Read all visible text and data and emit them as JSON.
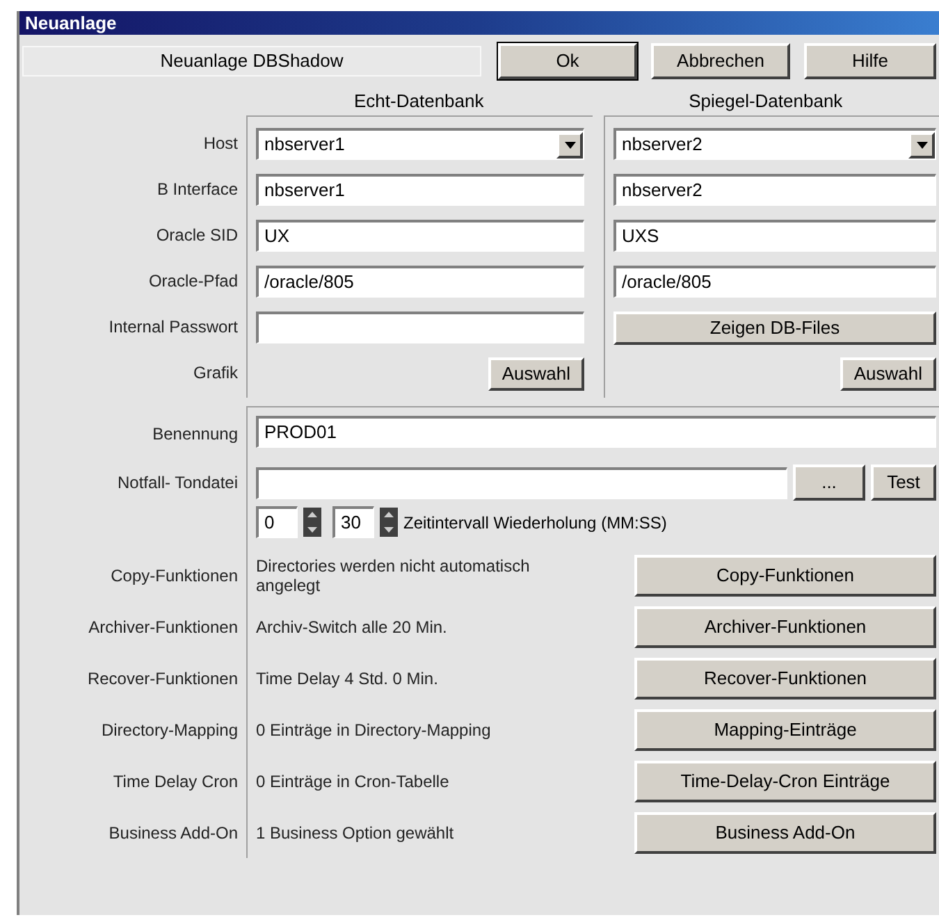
{
  "window": {
    "title": "Neuanlage"
  },
  "header": {
    "label": "Neuanlage DBShadow"
  },
  "buttons": [
    "Ok",
    "Abbrechen",
    "Hilfe"
  ],
  "columns": [
    "Echt-Datenbank",
    "Spiegel-Datenbank"
  ],
  "db_rows": [
    {
      "kind": "dropdown",
      "label": "Host",
      "left": "nbserver1",
      "right": "nbserver2"
    },
    {
      "kind": "text",
      "label": "B Interface",
      "left": "nbserver1",
      "right": "nbserver2"
    },
    {
      "kind": "text",
      "label": "Oracle SID",
      "left": "UX",
      "right": "UXS"
    },
    {
      "kind": "text",
      "label": "Oracle-Pfad",
      "left": "/oracle/805",
      "right": "/oracle/805"
    },
    {
      "kind": "field_button",
      "label": "Internal Passwort",
      "right": "Zeigen DB-Files"
    },
    {
      "kind": "buttons",
      "label": "Grafik",
      "left": "Auswahl",
      "right": "Auswahl"
    }
  ],
  "benennung": {
    "label": "Benennung",
    "value": "PROD01"
  },
  "notfall": {
    "label": "Notfall- Tondatei",
    "browse": "...",
    "test": "Test"
  },
  "interval": {
    "minutes": "0",
    "seconds": "30",
    "caption": "Zeitintervall Wiederholung (MM:SS)"
  },
  "functions": [
    {
      "label": "Copy-Funktionen",
      "description": "Directories werden nicht automatisch angelegt",
      "button": "Copy-Funktionen"
    },
    {
      "label": "Archiver-Funktionen",
      "description": "Archiv-Switch alle 20 Min.",
      "button": "Archiver-Funktionen"
    },
    {
      "label": "Recover-Funktionen",
      "description": "Time Delay 4 Std. 0 Min.",
      "button": "Recover-Funktionen"
    },
    {
      "label": "Directory-Mapping",
      "description": "0 Einträge in Directory-Mapping",
      "button": "Mapping-Einträge"
    },
    {
      "label": "Time Delay Cron",
      "description": "0 Einträge in Cron-Tabelle",
      "button": "Time-Delay-Cron Einträge"
    },
    {
      "label": "Business Add-On",
      "description": "1 Business Option gewählt",
      "button": "Business Add-On"
    }
  ]
}
